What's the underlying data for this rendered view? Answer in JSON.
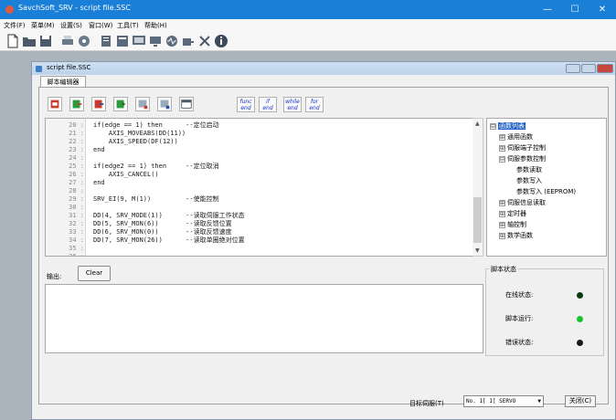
{
  "window": {
    "title": "SavchSoft_SRV - script file.SSC"
  },
  "menu": [
    "文件(F)",
    "菜单(M)",
    "设置(S)",
    "窗口(W)",
    "工具(T)",
    "帮助(H)"
  ],
  "child": {
    "title": "script file.SSC",
    "tab": "脚本编辑器"
  },
  "keywords": [
    {
      "a": "func",
      "b": "end"
    },
    {
      "a": "if",
      "b": "end"
    },
    {
      "a": "while",
      "b": "end"
    },
    {
      "a": "for",
      "b": "end"
    }
  ],
  "code": {
    "line_numbers": [
      "20",
      "21",
      "22",
      "23",
      "24",
      "25",
      "26",
      "27",
      "28",
      "29",
      "30",
      "31",
      "32",
      "33",
      "34",
      "35",
      "36"
    ],
    "lines": [
      "if(edge == 1) then      --定位启动",
      "    AXIS_MOVEABS(DD(11))",
      "    AXIS_SPEED(DF(12))",
      "end",
      "",
      "if(edge2 == 1) then     --定位取消",
      "    AXIS_CANCEL()",
      "end",
      "",
      "SRV_EI(9, M(1))         --使能控制",
      "",
      "DD(4, SRV_MODE(1))      --读取伺服工作状态",
      "DD(5, SRV_MON(6))       --读取反馈位置",
      "DD(6, SRV_MON(0))       --读取反馈速度",
      "DD(7, SRV_MON(26))      --读取单圈绝对位置",
      "",
      ""
    ]
  },
  "tree": [
    {
      "label": "函数列表",
      "exp": "⊟",
      "level": 0,
      "selected": true
    },
    {
      "label": "通用函数",
      "exp": "⊞",
      "level": 1
    },
    {
      "label": "伺服端子控制",
      "exp": "⊞",
      "level": 1
    },
    {
      "label": "伺服参数控制",
      "exp": "⊟",
      "level": 1
    },
    {
      "label": "参数读取",
      "exp": "",
      "level": 2
    },
    {
      "label": "参数写入",
      "exp": "",
      "level": 2
    },
    {
      "label": "参数写入 (EEPROM)",
      "exp": "",
      "level": 2
    },
    {
      "label": "伺服信息读取",
      "exp": "⊞",
      "level": 1
    },
    {
      "label": "定时器",
      "exp": "⊞",
      "level": 1
    },
    {
      "label": "轴控制",
      "exp": "⊞",
      "level": 1
    },
    {
      "label": "数学函数",
      "exp": "⊞",
      "level": 1
    }
  ],
  "output": {
    "label": "输出:",
    "clear": "Clear"
  },
  "status": {
    "title": "脚本状态",
    "items": [
      {
        "label": "在线状态:",
        "color": "#0a3a12"
      },
      {
        "label": "脚本运行:",
        "color": "#19c42a"
      },
      {
        "label": "错误状态:",
        "color": "#1a1a1a"
      }
    ]
  },
  "bottom": {
    "target_label": "目标伺服(T)",
    "target_value": "No. 1[  1] SERVO",
    "close": "关闭(C)"
  }
}
